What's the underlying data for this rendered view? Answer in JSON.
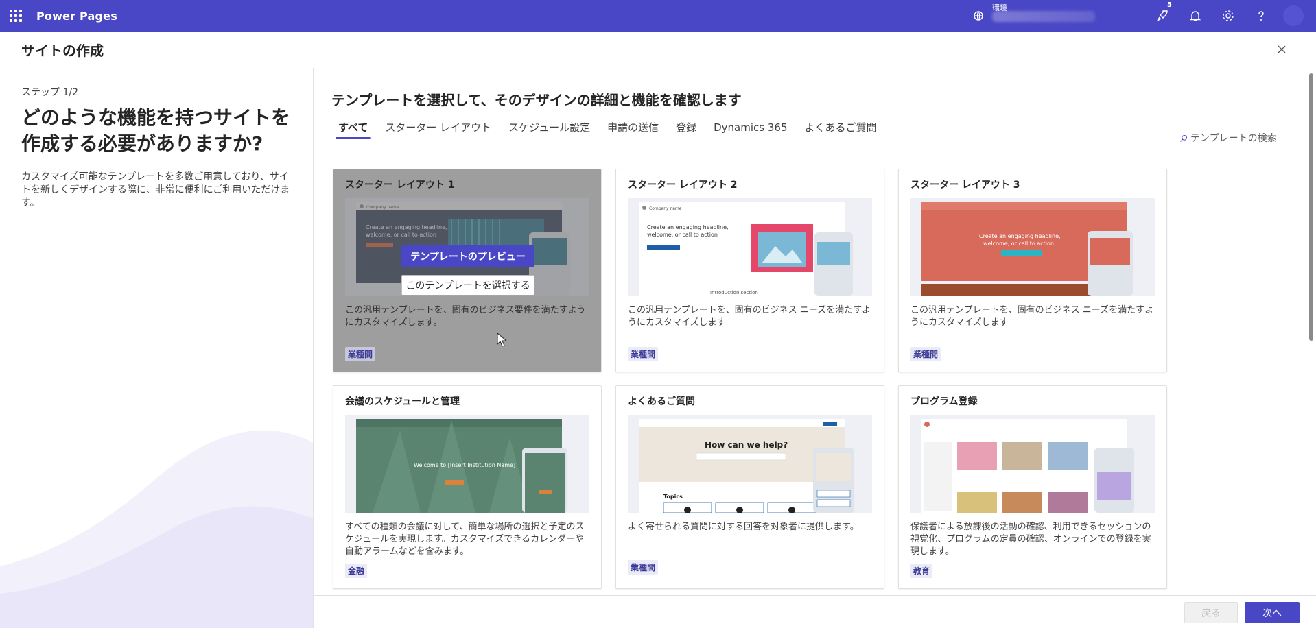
{
  "app": {
    "name": "Power Pages"
  },
  "topbar": {
    "environment_label": "環境",
    "notification_badge": "5"
  },
  "header": {
    "title": "サイトの作成"
  },
  "left_panel": {
    "step": "ステップ 1/2",
    "question": "どのような機能を持つサイトを作成する必要がありますか?",
    "description": "カスタマイズ可能なテンプレートを多数ご用意しており、サイトを新しくデザインする際に、非常に便利にご利用いただけます。"
  },
  "main": {
    "heading": "テンプレートを選択して、そのデザインの詳細と機能を確認します",
    "tabs": [
      {
        "label": "すべて",
        "active": true
      },
      {
        "label": "スターター レイアウト"
      },
      {
        "label": "スケジュール設定"
      },
      {
        "label": "申請の送信"
      },
      {
        "label": "登録"
      },
      {
        "label": "Dynamics 365"
      },
      {
        "label": "よくあるご質問"
      }
    ],
    "search_placeholder": "テンプレートの検索"
  },
  "cards": [
    {
      "title": "スターター レイアウト 1",
      "description": "この汎用テンプレートを、固有のビジネス要件を満たすようにカスタマイズします。",
      "tag": "業種間",
      "hovered": true,
      "preview_button": "テンプレートのプレビュー",
      "select_button": "このテンプレートを選択する"
    },
    {
      "title": "スターター レイアウト 2",
      "description": "この汎用テンプレートを、固有のビジネス ニーズを満たすようにカスタマイズします",
      "tag": "業種間"
    },
    {
      "title": "スターター レイアウト 3",
      "description": "この汎用テンプレートを、固有のビジネス ニーズを満たすようにカスタマイズします",
      "tag": "業種間"
    },
    {
      "title": "会議のスケジュールと管理",
      "description": "すべての種類の会議に対して、簡単な場所の選択と予定のスケジュールを実現します。カスタマイズできるカレンダーや自動アラームなどを含みます。",
      "tag": "金融"
    },
    {
      "title": "よくあるご質問",
      "description": "よく寄せられる質問に対する回答を対象者に提供します。",
      "tag": "業種間"
    },
    {
      "title": "プログラム登録",
      "description": "保護者による放課後の活動の確認、利用できるセッションの視覚化、プログラムの定員の確認、オンラインでの登録を実現します。",
      "tag": "教育"
    }
  ],
  "thumbnails": {
    "company_name": "Company name",
    "hero_headline": "Create an engaging headline, welcome, or call to action",
    "intro_section": "Introduction section",
    "institution_welcome": "Welcome to [Insert Institution Name]",
    "help_heading": "How can we help?",
    "topics_label": "Topics"
  },
  "footer": {
    "back_label": "戻る",
    "next_label": "次へ"
  },
  "colors": {
    "brand": "#4a47c6",
    "tag_bg": "#ebebf7"
  }
}
